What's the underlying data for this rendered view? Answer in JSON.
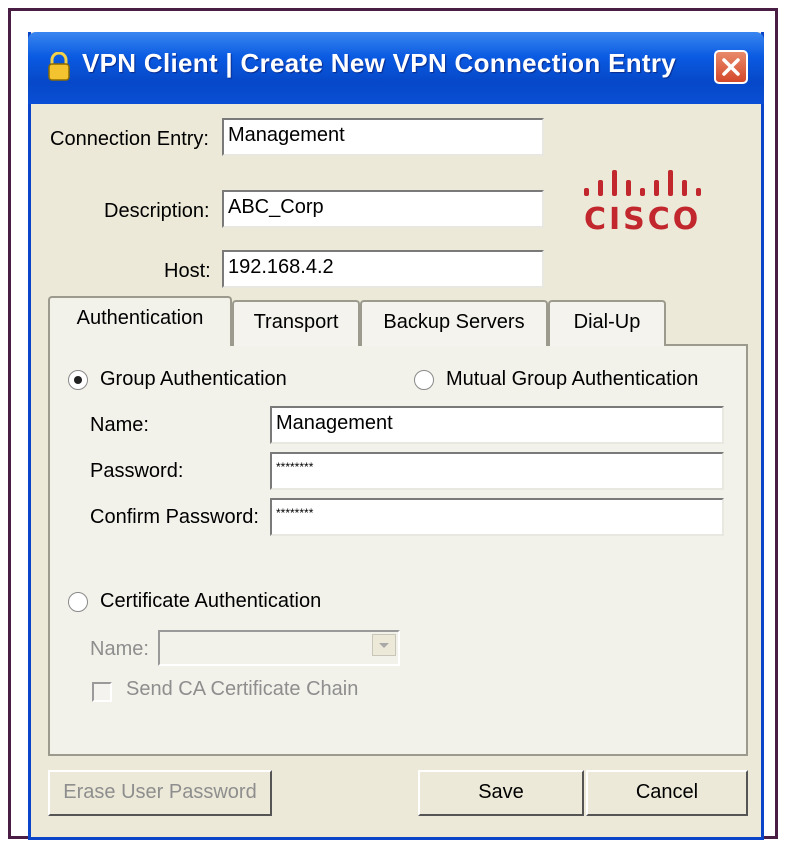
{
  "window": {
    "title": "VPN Client  |  Create New VPN Connection Entry"
  },
  "fields": {
    "connection_entry_label": "Connection Entry:",
    "connection_entry_value": "Management",
    "description_label": "Description:",
    "description_value": "ABC_Corp",
    "host_label": "Host:",
    "host_value": "192.168.4.2"
  },
  "logo": {
    "text": "CISCO"
  },
  "tabs": [
    {
      "label": "Authentication",
      "active": true
    },
    {
      "label": "Transport",
      "active": false
    },
    {
      "label": "Backup Servers",
      "active": false
    },
    {
      "label": "Dial-Up",
      "active": false
    }
  ],
  "auth": {
    "group_auth_label": "Group Authentication",
    "group_auth_selected": true,
    "mutual_group_auth_label": "Mutual Group Authentication",
    "name_label": "Name:",
    "name_value": "Management",
    "password_label": "Password:",
    "password_value": "********",
    "confirm_password_label": "Confirm Password:",
    "confirm_password_value": "********",
    "cert_auth_label": "Certificate Authentication",
    "cert_name_label": "Name:",
    "cert_name_value": "",
    "send_ca_chain_label": "Send CA Certificate Chain"
  },
  "buttons": {
    "erase_password": "Erase User Password",
    "save": "Save",
    "cancel": "Cancel"
  },
  "colors": {
    "title_bar": "#0a5ae2",
    "window_bg": "#ece9d8",
    "close_button": "#d4482a",
    "cisco_logo": "#c1272d"
  }
}
